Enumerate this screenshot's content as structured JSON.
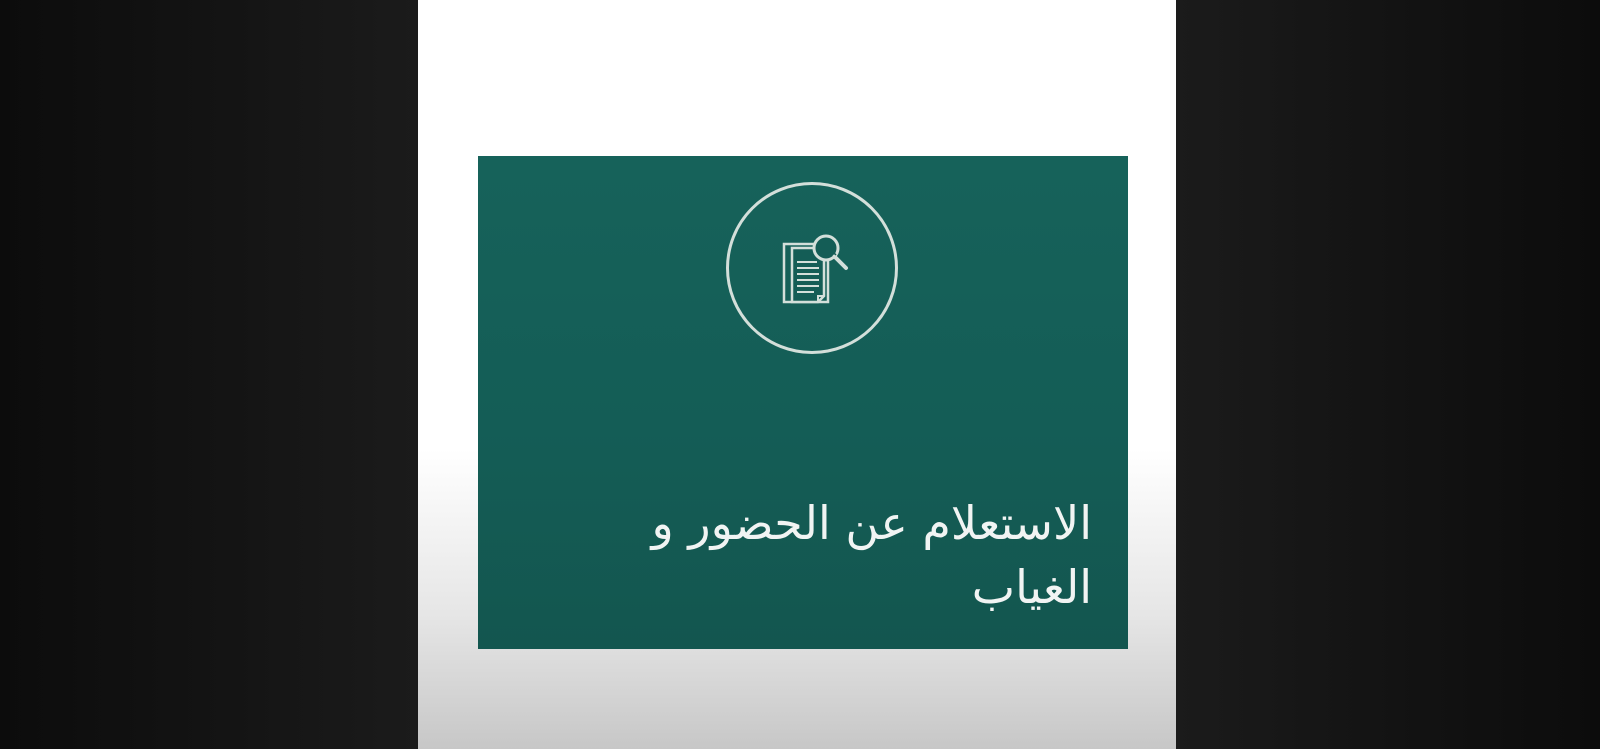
{
  "card": {
    "title": "الاستعلام عن الحضور و الغياب",
    "icon": "document-search-icon",
    "background_color": "#145d56",
    "accent_color": "#d3dfda"
  }
}
